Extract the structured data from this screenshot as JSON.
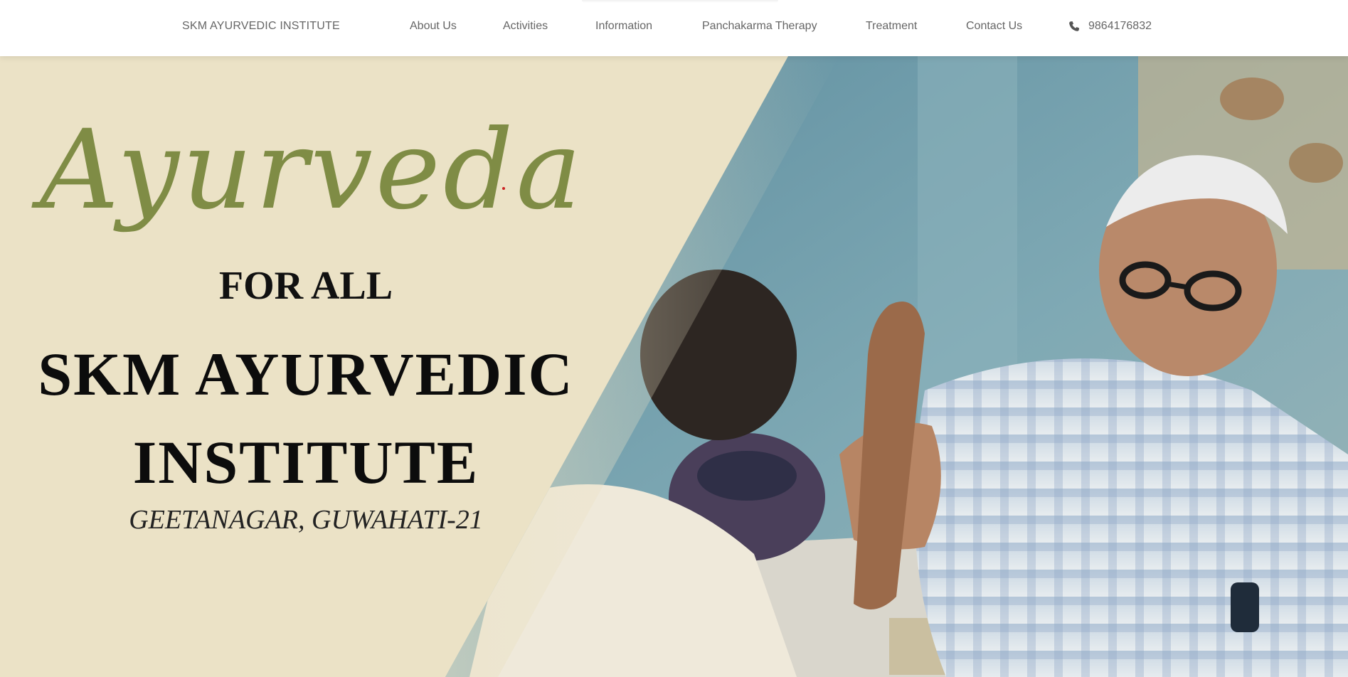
{
  "nav": {
    "brand": "SKM AYURVEDIC INSTITUTE",
    "links": [
      {
        "label": "About Us"
      },
      {
        "label": "Activities"
      },
      {
        "label": "Information"
      },
      {
        "label": "Panchakarma Therapy"
      },
      {
        "label": "Treatment"
      },
      {
        "label": "Contact Us"
      }
    ],
    "phone": {
      "icon": "phone-icon",
      "number": "9864176832"
    }
  },
  "hero": {
    "script_title": "Ayurveda",
    "for_all": "FOR ALL",
    "title_line1": "SKM AYURVEDIC",
    "title_line2": "INSTITUTE",
    "location": "GEETANAGAR, GUWAHATI-21"
  },
  "colors": {
    "nav_text": "#666666",
    "hero_bg": "#ebe2c6",
    "script_green": "#7f8c45",
    "title_black": "#0c0c0c"
  }
}
